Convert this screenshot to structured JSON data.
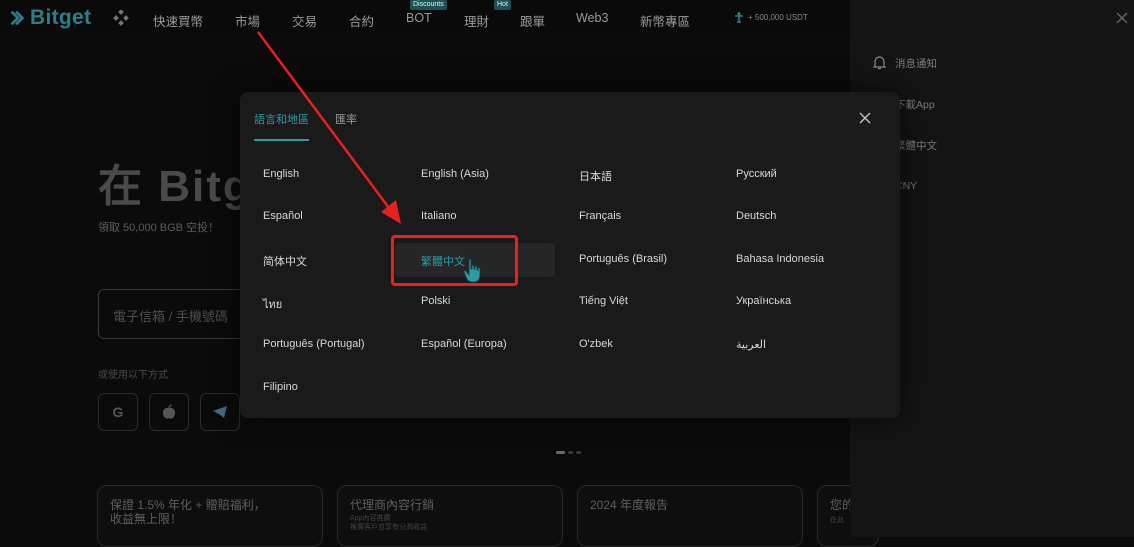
{
  "header": {
    "logo_text": "Bitget",
    "nav": [
      {
        "label": "快速買幣"
      },
      {
        "label": "市場"
      },
      {
        "label": "交易"
      },
      {
        "label": "合約"
      },
      {
        "label": "BOT",
        "badge": "Discounts"
      },
      {
        "label": "理財",
        "badge": "Hot"
      },
      {
        "label": "跟單"
      },
      {
        "label": "Web3"
      },
      {
        "label": "新幣專區"
      }
    ],
    "promo_text": "+ 500,000 USDT"
  },
  "hero": {
    "title": "在 Bitg",
    "subtitle": "領取 50,000 BGB 空投！",
    "input_placeholder": "電子信箱 / 手機號碼",
    "or_text": "或使用以下方式"
  },
  "cards": [
    {
      "title": "保證 1.5% 年化 + 贈賠福利，",
      "title2": "收益無上限！"
    },
    {
      "title": "代理商內容行銷",
      "sub1": "App內容推廣",
      "sub2": "推廣客戶並享有分潤收益"
    },
    {
      "title": "2024 年度報告"
    },
    {
      "title": "您的",
      "sub1": "在此"
    }
  ],
  "side_panel": {
    "items": [
      {
        "label": "消息通知"
      },
      {
        "label": "下載App"
      },
      {
        "label": "繁體中文"
      },
      {
        "label": "CNY"
      }
    ]
  },
  "modal": {
    "tabs": [
      {
        "label": "語言和地區",
        "active": true
      },
      {
        "label": "匯率",
        "active": false
      }
    ],
    "languages": [
      [
        "English",
        "English (Asia)",
        "日本語",
        "Русский"
      ],
      [
        "Español",
        "Italiano",
        "Français",
        "Deutsch"
      ],
      [
        "简体中文",
        "繁體中文",
        "Português (Brasil)",
        "Bahasa Indonesia"
      ],
      [
        "ไทย",
        "Polski",
        "Tiếng Việt",
        "Українська"
      ],
      [
        "Português (Portugal)",
        "Español (Europa)",
        "O'zbek",
        "العربية"
      ],
      [
        "Filipino"
      ]
    ],
    "selected_language": "繁體中文"
  },
  "colors": {
    "accent": "#2f9aa1",
    "highlight_box": "#e8201f",
    "modal_bg": "#1a1a1a",
    "page_bg": "#0b0b0b"
  }
}
